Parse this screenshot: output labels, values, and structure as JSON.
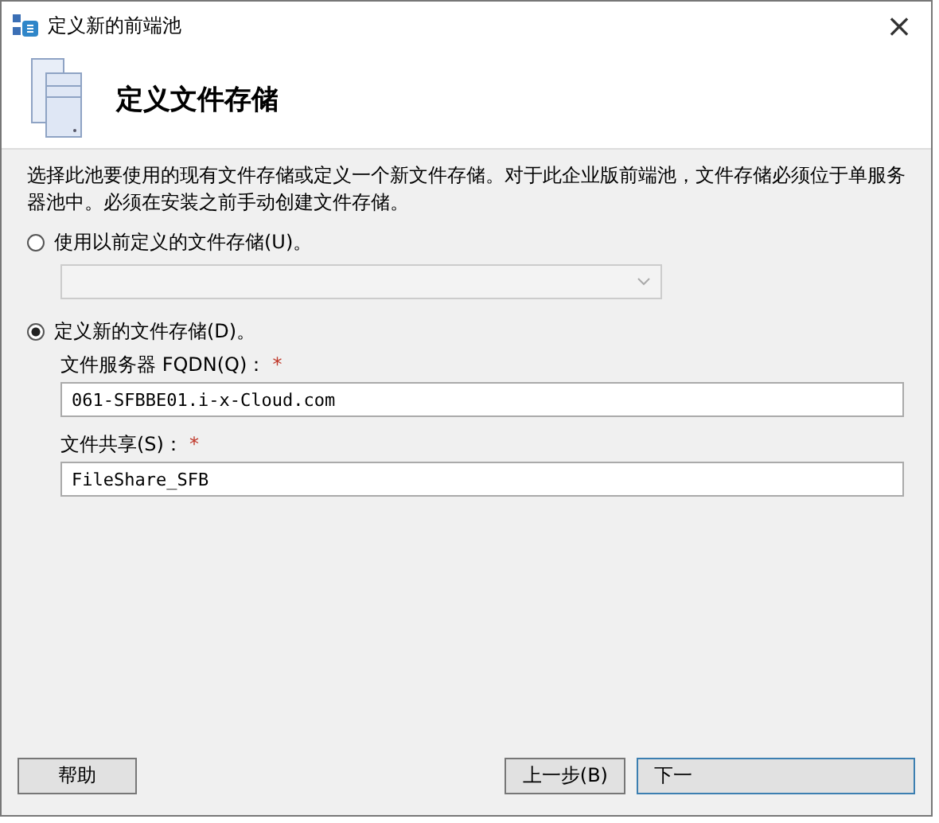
{
  "window": {
    "title": "定义新的前端池",
    "close": "×"
  },
  "header": {
    "title": "定义文件存储"
  },
  "description": "选择此池要使用的现有文件存储或定义一个新文件存储。对于此企业版前端池，文件存储必须位于单服务器池中。必须在安装之前手动创建文件存储。",
  "options": [
    {
      "kind": "dropdown",
      "label": "使用以前定义的文件存储(U)。",
      "selected": false,
      "disabled": true
    },
    {
      "kind": "fields",
      "label": "定义新的文件存储(D)。",
      "selected": true,
      "fields": [
        {
          "label": "文件服务器 FQDN(Q)：",
          "required_mark": "*",
          "value": "061-SFBBE01.i-x-Cloud.com"
        },
        {
          "label": "文件共享(S)：",
          "required_mark": "*",
          "value": "FileShare_SFB"
        }
      ]
    }
  ],
  "buttons": {
    "help": "帮助",
    "back": "上一步(B)",
    "next": "下一"
  }
}
